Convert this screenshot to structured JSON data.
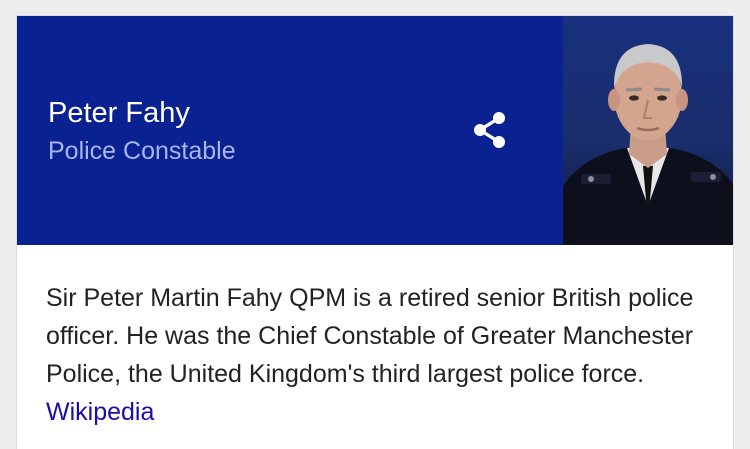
{
  "panel": {
    "name": "Peter Fahy",
    "subtitle": "Police Constable",
    "share_icon": "share-icon",
    "image": "portrait-photo"
  },
  "description": {
    "text": "Sir Peter Martin Fahy QPM is a retired senior British police officer. He was the Chief Constable of Greater Manchester Police, the United Kingdom's third largest police force.",
    "source_link": "Wikipedia"
  },
  "colors": {
    "header_background": "#0a2192",
    "name_text": "#ffffff",
    "subtitle_text": "#a9b6ee",
    "link": "#1a0dab",
    "body_text": "#222222"
  }
}
